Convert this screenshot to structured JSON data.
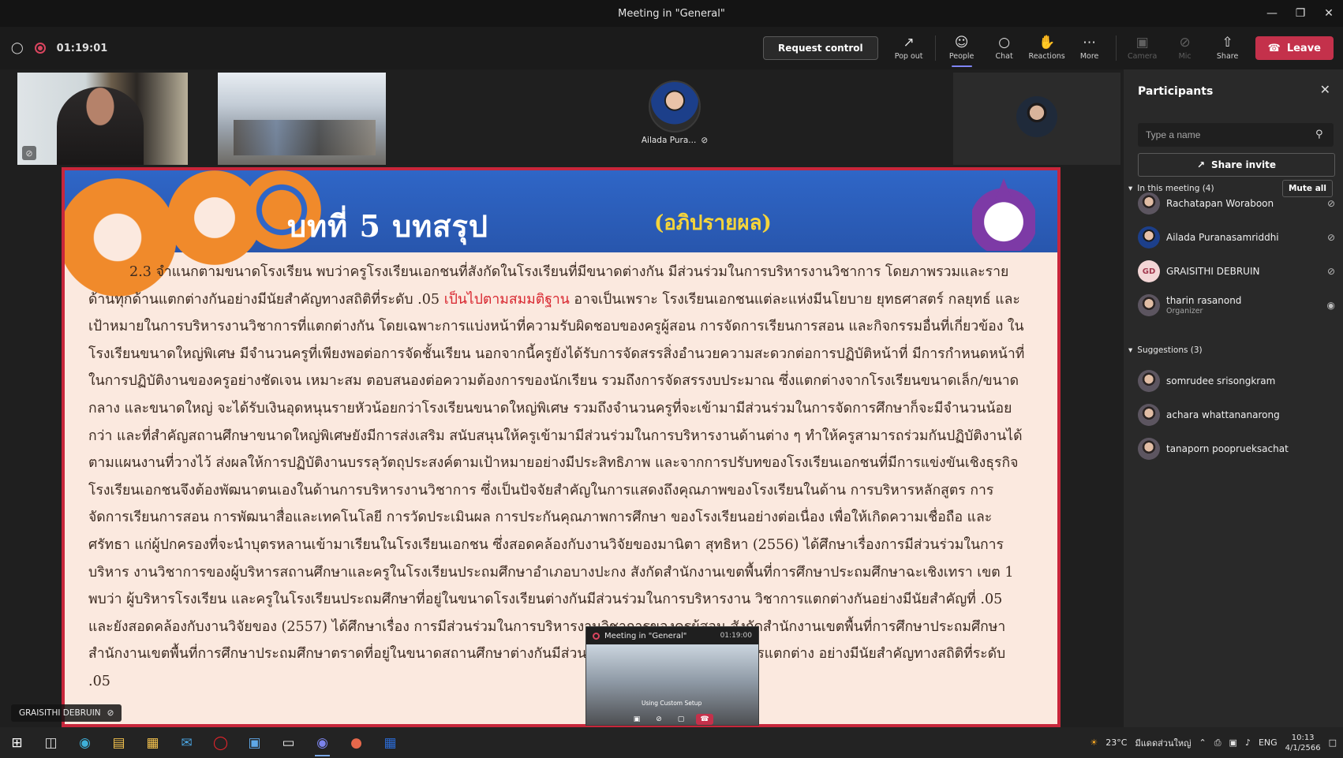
{
  "window": {
    "title": "Meeting in \"General\""
  },
  "toolbar": {
    "timer": "01:19:01",
    "request_control": "Request control",
    "pop_out": "Pop out",
    "people": "People",
    "chat": "Chat",
    "reactions": "Reactions",
    "more": "More",
    "camera": "Camera",
    "mic": "Mic",
    "share": "Share",
    "leave": "Leave"
  },
  "stage": {
    "avatar_tile_name": "Ailada Pura...",
    "speaker_label": "GRAISITHI DEBRUIN"
  },
  "slide": {
    "title": "บทที่ 5 บทสรุป",
    "subtitle": "(อภิปรายผล)",
    "paragraph_start": "2.3 จำแนกตามขนาดโรงเรียน พบว่าครูโรงเรียนเอกชนที่สังกัดในโรงเรียนที่มีขนาดต่างกัน มีส่วนร่วมในการบริหารงานวิชาการ โดยภาพรวมและรายด้านทุกด้านแตกต่างกันอย่างมีนัยสำคัญทางสถิติที่ระดับ .05 ",
    "highlight": "เป็นไปตามสมมติฐาน",
    "paragraph_rest": " อาจเป็นเพราะ โรงเรียนเอกชนแต่ละแห่งมีนโยบาย ยุทธศาสตร์ กลยุทธ์ และเป้าหมายในการบริหารงานวิชาการที่แตกต่างกัน โดยเฉพาะการแบ่งหน้าที่ความรับผิดชอบของครูผู้สอน การจัดการเรียนการสอน และกิจกรรมอื่นที่เกี่ยวข้อง ในโรงเรียนขนาดใหญ่พิเศษ มีจำนวนครูที่เพียงพอต่อการจัดชั้นเรียน นอกจากนี้ครูยังได้รับการจัดสรรสิ่งอำนวยความสะดวกต่อการปฏิบัติหน้าที่ มีการกำหนดหน้าที่ในการปฏิบัติงานของครูอย่างชัดเจน เหมาะสม ตอบสนองต่อความต้องการของนักเรียน รวมถึงการจัดสรรงบประมาณ ซึ่งแตกต่างจากโรงเรียนขนาดเล็ก/ขนาดกลาง และขนาดใหญ่ จะได้รับเงินอุดหนุนรายหัวน้อยกว่าโรงเรียนขนาดใหญ่พิเศษ รวมถึงจำนวนครูที่จะเข้ามามีส่วนร่วมในการจัดการศึกษาก็จะมีจำนวนน้อยกว่า และที่สำคัญสถานศึกษาขนาดใหญ่พิเศษยังมีการส่งเสริม สนับสนุนให้ครูเข้ามามีส่วนร่วมในการบริหารงานด้านต่าง ๆ ทำให้ครูสามารถร่วมกันปฏิบัติงานได้ตามแผนงานที่วางไว้ ส่งผลให้การปฏิบัติงานบรรลุวัตถุประสงค์ตามเป้าหมายอย่างมีประสิทธิภาพ และจากการปรับทของโรงเรียนเอกชนที่มีการแข่งขันเชิงธุรกิจโรงเรียนเอกชนจึงต้องพัฒนาตนเองในด้านการบริหารงานวิชาการ ซึ่งเป็นปัจจัยสำคัญในการแสดงถึงคุณภาพของโรงเรียนในด้าน การบริหารหลักสูตร การจัดการเรียนการสอน การพัฒนาสื่อและเทคโนโลยี การวัดประเมินผล การประกันคุณภาพการศึกษา ของโรงเรียนอย่างต่อเนื่อง เพื่อให้เกิดความเชื่อถือ และศรัทธา แก่ผู้ปกครองที่จะนำบุตรหลานเข้ามาเรียนในโรงเรียนเอกชน ซึ่งสอดคล้องกับงานวิจัยของมานิตา สุทธิหา (2556) ได้ศึกษาเรื่องการมีส่วนร่วมในการบริหาร งานวิชาการของผู้บริหารสถานศึกษาและครูในโรงเรียนประถมศึกษาอำเภอบางปะกง สังกัดสำนักงานเขตพื้นที่การศึกษาประถมศึกษาฉะเชิงเทรา เขต 1 พบว่า ผู้บริหารโรงเรียน และครูในโรงเรียนประถมศึกษาที่อยู่ในขนาดโรงเรียนต่างกันมีส่วนร่วมในการบริหารงาน วิชาการแตกต่างกันอย่างมีนัยสำคัญที่ .05 และยังสอดคล้องกับงานวิจัยของ (2557) ได้ศึกษาเรื่อง การมีส่วนร่วมในการบริหารงานวิชาการของครูผู้สอน สังกัดสำนักงานเขตพื้นที่การศึกษาประถมศึกษา สำนักงานเขตพื้นที่การศึกษาประถมศึกษาตราดที่อยู่ในขนาดสถานศึกษาต่างกันมีส่วนร่วมในการบริหารงานวิชาการแตกต่าง อย่างมีนัยสำคัญทางสถิติที่ระดับ .05"
  },
  "selfview": {
    "title": "Meeting in \"General\"",
    "time": "01:19:00",
    "caption": "Using Custom Setup"
  },
  "panel": {
    "title": "Participants",
    "search_placeholder": "Type a name",
    "share_invite": "Share invite",
    "in_meeting_label": "In this meeting (4)",
    "mute_all": "Mute all",
    "suggestions_label": "Suggestions (3)",
    "participants": [
      {
        "name": "Rachatapan Woraboon",
        "sub": ""
      },
      {
        "name": "Ailada Puranasamriddhi",
        "sub": ""
      },
      {
        "name": "GRAISITHI DEBRUIN",
        "sub": "",
        "initials": "GD"
      },
      {
        "name": "tharin rasanond",
        "sub": "Organizer"
      }
    ],
    "suggestions": [
      {
        "name": "somrudee srisongkram"
      },
      {
        "name": "achara whattananarong"
      },
      {
        "name": "tanaporn pooprueksachat"
      }
    ]
  },
  "taskbar": {
    "weather": "23°C",
    "weather_text": "มีแดดส่วนใหญ่",
    "language": "ENG",
    "time": "10:13",
    "date": "4/1/2566"
  },
  "colors": {
    "leave": "#c4314b",
    "accent": "#7f85f5",
    "slide_banner": "#2f66c7",
    "slide_border": "#c7263b",
    "highlight_text": "#d8262f"
  }
}
